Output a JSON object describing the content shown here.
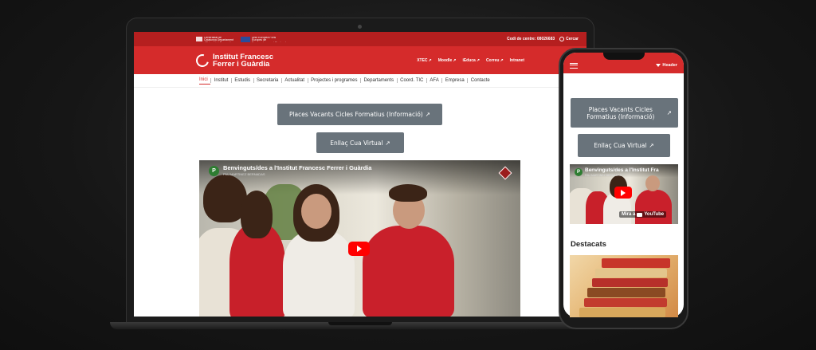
{
  "laptop": {
    "topbar": {
      "gov_logo_1": "Generalitat de Catalunya Departament d'Educació i Formació Professional",
      "gov_logo_2": "Unió Europea Fons Europeu de Desenvolupament Regional",
      "code_label": "Codi de centre: 08026683",
      "search_label": "Cercar"
    },
    "header": {
      "brand_line1": "Institut Francesc",
      "brand_line2": "Ferrer i Guàrdia",
      "links": [
        "XTEC",
        "Moodle",
        "iEduca",
        "Correu",
        "Intranet"
      ]
    },
    "nav": [
      "Inici",
      "Institut",
      "Estudis",
      "Secretaria",
      "Actualitat",
      "Projectes i programes",
      "Departaments",
      "Coord. TIC",
      "AFA",
      "Empresa",
      "Contacte"
    ],
    "buttons": {
      "places": "Places Vacants Cicles Formatius (Informació)",
      "cua": "Enllaç Cua Virtual"
    },
    "video": {
      "avatar": "P",
      "title": "Benvinguts/des a l'Institut Francesc Ferrer i Guàrdia",
      "channel": "PAU MARTINEZ BERNADAS"
    }
  },
  "phone": {
    "header_label": "Header",
    "buttons": {
      "places": "Places Vacants Cicles Formatius (Informació)",
      "cua": "Enllaç Cua Virtual"
    },
    "video": {
      "avatar": "P",
      "title": "Benvinguts/des a l'Institut Fra",
      "channel": "PAU MARTINEZ BERNADAS",
      "watch_on": "Mira a",
      "youtube": "YouTube"
    },
    "section_title": "Destacats"
  },
  "colors": {
    "brand_red": "#d52b2b",
    "topbar_red": "#b51f1f",
    "button_gray": "#69737b"
  },
  "icons": [
    "external-link-icon",
    "search-icon",
    "hamburger-icon",
    "youtube-play-icon"
  ]
}
